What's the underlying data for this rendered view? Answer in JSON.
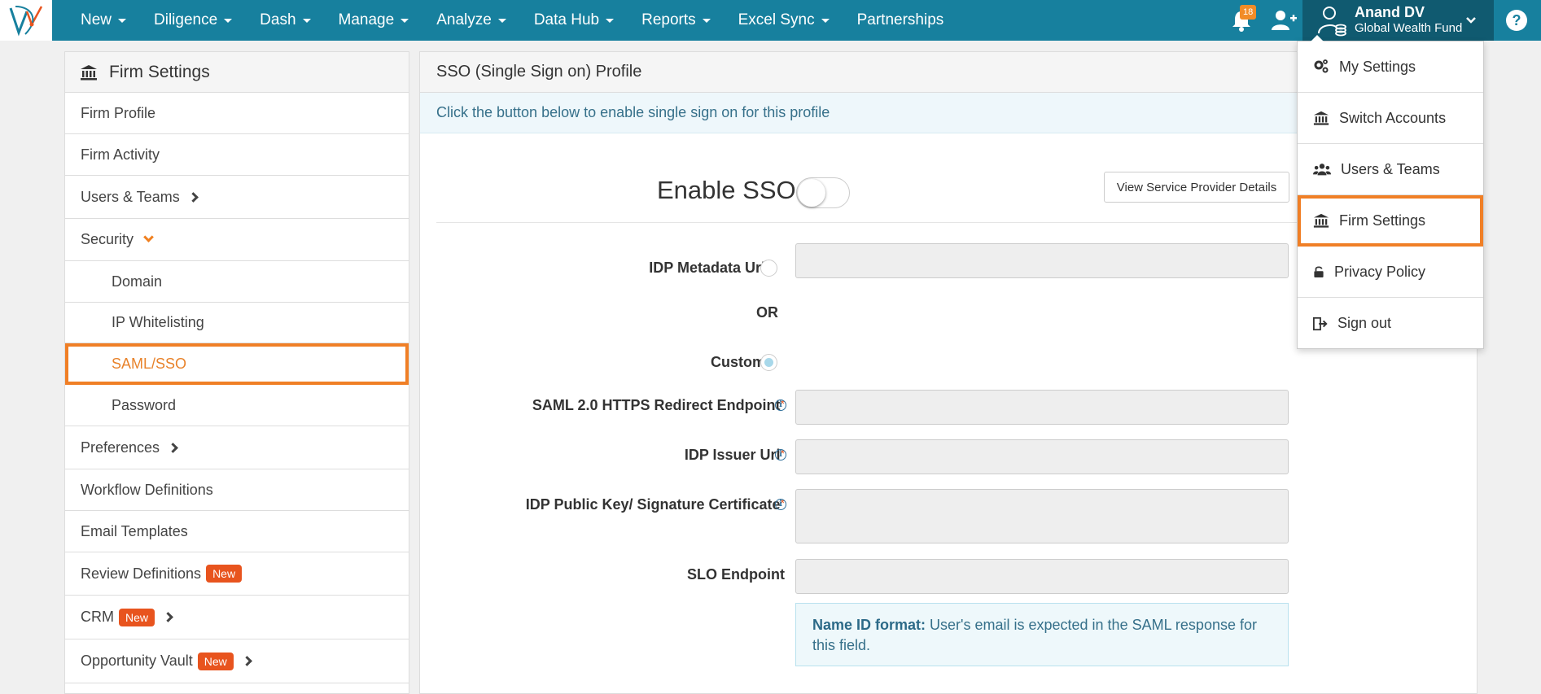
{
  "nav": {
    "items": [
      {
        "label": "New",
        "dropdown": true
      },
      {
        "label": "Diligence",
        "dropdown": true
      },
      {
        "label": "Dash",
        "dropdown": true
      },
      {
        "label": "Manage",
        "dropdown": true
      },
      {
        "label": "Analyze",
        "dropdown": true
      },
      {
        "label": "Data Hub",
        "dropdown": true
      },
      {
        "label": "Reports",
        "dropdown": true
      },
      {
        "label": "Excel Sync",
        "dropdown": true
      },
      {
        "label": "Partnerships",
        "dropdown": false
      }
    ],
    "notification_count": "18",
    "user_name": "Anand DV",
    "user_org": "Global Wealth Fund",
    "help_label": "?"
  },
  "sidebar": {
    "title": "Firm Settings",
    "items": {
      "firm_profile": "Firm Profile",
      "firm_activity": "Firm Activity",
      "users_teams": "Users & Teams",
      "security": "Security",
      "domain": "Domain",
      "ip_whitelisting": "IP Whitelisting",
      "saml_sso": "SAML/SSO",
      "password": "Password",
      "preferences": "Preferences",
      "workflow_definitions": "Workflow Definitions",
      "email_templates": "Email Templates",
      "review_definitions": "Review Definitions",
      "crm": "CRM",
      "opportunity_vault": "Opportunity Vault"
    },
    "new_badge": "New"
  },
  "main": {
    "title": "SSO (Single Sign on) Profile",
    "info": "Click the button below to enable single sign on for this profile",
    "enable_label": "Enable SSO",
    "spd_button": "View Service Provider Details",
    "idp_metadata_label": "IDP Metadata Url",
    "or_label": "OR",
    "custom_label": "Custom",
    "saml_redirect_label": "SAML 2.0 HTTPS Redirect Endpoint",
    "idp_issuer_label": "IDP Issuer Url",
    "idp_key_label": "IDP Public Key/ Signature Certificate",
    "slo_label": "SLO Endpoint",
    "required_mark": "*",
    "note_bold": "Name ID format:",
    "note_text": " User's email is expected in the SAML response for this field."
  },
  "dropdown": {
    "my_settings": "My Settings",
    "switch_accounts": "Switch Accounts",
    "users_teams": "Users & Teams",
    "firm_settings": "Firm Settings",
    "privacy_policy": "Privacy Policy",
    "sign_out": "Sign out"
  },
  "colors": {
    "nav_bg": "#17809e",
    "user_bg": "#105a70",
    "highlight": "#f07f26",
    "badge_new": "#e8541e"
  }
}
